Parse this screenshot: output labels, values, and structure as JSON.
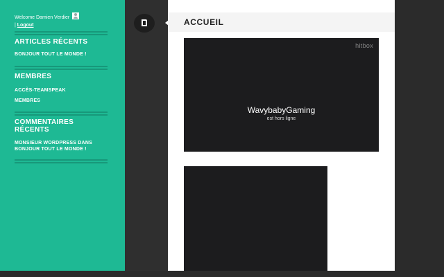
{
  "sidebar": {
    "welcome_text": "Welcome Damien Verdier",
    "separator": "|",
    "logout_label": "Logout",
    "widgets": [
      {
        "title": "ARTICLES RÉCENTS",
        "links": [
          "BONJOUR TOUT LE MONDE !"
        ]
      },
      {
        "title": "MEMBRES",
        "links": [
          "ACCÈS-TEAMSPEAK",
          "MEMBRES"
        ]
      },
      {
        "title": "COMMENTAIRES RÉCENTS",
        "links": [
          "MONSIEUR WORDPRESS DANS BONJOUR TOUT LE MONDE !"
        ]
      }
    ]
  },
  "post": {
    "icon": "document-icon",
    "title": "ACCUEIL"
  },
  "stream": {
    "brand": "hitbox",
    "channel": "WavybabyGaming",
    "status": "est hors ligne"
  },
  "colors": {
    "sidebar": "#1eb994",
    "dark": "#2b2b2b",
    "player": "#1c1c1e"
  }
}
